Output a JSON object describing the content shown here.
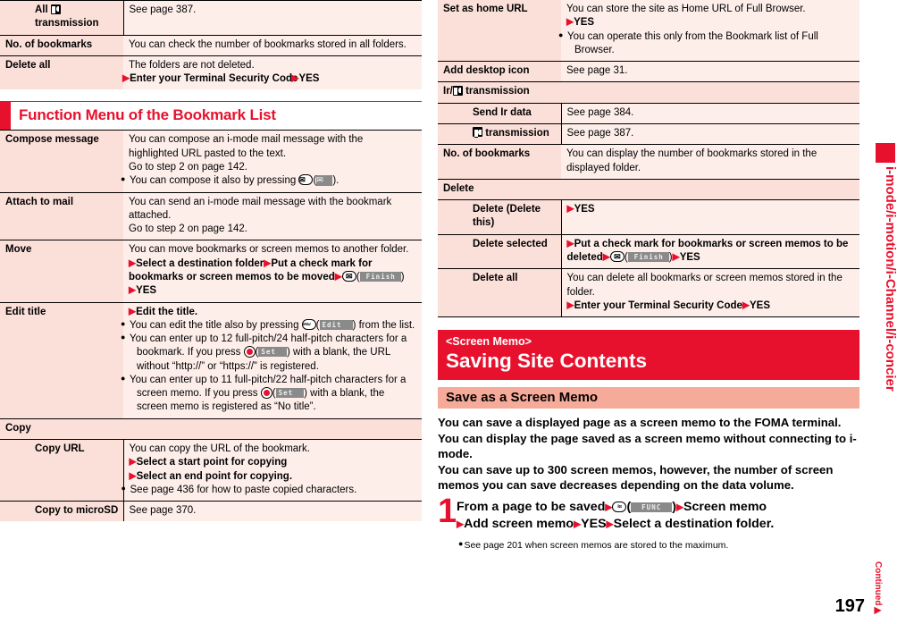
{
  "page_number": "197",
  "continued_label": "Continued",
  "side_tab_label": "i-mode/i-motion/i-Channel/i-concier",
  "colors": {
    "accent_red": "#e8112d",
    "label_pink": "#fbdfd9",
    "desc_pink": "#fdeeea",
    "subhead_pink": "#f6aa9a"
  },
  "left_column": {
    "top_table": {
      "rows": [
        {
          "label_prefix": "All",
          "label_icon": "ic-transmission-icon",
          "label_suffix": "transmission",
          "nested": true,
          "desc": "See page 387."
        },
        {
          "label": "No. of bookmarks",
          "desc": "You can check the number of bookmarks stored in all folders."
        },
        {
          "label": "Delete all",
          "desc_line1": "The folders are not deleted.",
          "desc_line2_tri": "▶",
          "desc_line2_bold": "Enter your Terminal Security Code",
          "desc_line2_tri2": "▶",
          "desc_line2_bold2": "YES"
        }
      ]
    },
    "section_heading": "Function Menu of the Bookmark List",
    "fn_table": {
      "rows": [
        {
          "label": "Compose message",
          "lines": [
            "You can compose an i-mode mail message with the",
            "highlighted URL pasted to the text.",
            "Go to step 2 on page 142."
          ],
          "note": "You can compose it also by pressing",
          "note_key": "envelope-key",
          "note_softkey": "envelope-softkey",
          "note_tail": "."
        },
        {
          "label": "Attach to mail",
          "lines": [
            "You can send an i-mode mail message with the bookmark",
            "attached.",
            "Go to step 2 on page 142."
          ]
        },
        {
          "label": "Move",
          "lines": [
            "You can move bookmarks or screen memos to another folder."
          ],
          "steps_bold": "Select a destination folder",
          "steps_bold2": "Put a check mark for bookmarks or screen memos to be moved",
          "steps_softkey": "Finish",
          "steps_bold3": "YES"
        },
        {
          "label": "Edit title",
          "steps_bold": "Edit the title.",
          "notes": [
            {
              "pre": "You can edit the title also by pressing",
              "key": "menu-key",
              "softkey": "Edit",
              "post": ") from the list."
            },
            {
              "pre": "You can enter up to 12 full-pitch/24 half-pitch characters for a bookmark. If you press",
              "key": "ok-key",
              "softkey": "Set",
              "post": ") with a blank, the URL without “http://” or “https://” is registered."
            },
            {
              "pre": "You can enter up to 11 full-pitch/22 half-pitch characters for a screen memo. If you press",
              "key": "ok-key",
              "softkey": "Set",
              "post": ") with a blank, the screen memo is registered as “No title”."
            }
          ]
        },
        {
          "group_label": "Copy"
        },
        {
          "label": "Copy URL",
          "nested": true,
          "lines": [
            "You can copy the URL of the bookmark."
          ],
          "steps_bold": "Select a start point for copying",
          "steps_bold2": "Select an end point for copying.",
          "note": "See page 436 for how to paste copied characters."
        },
        {
          "label": "Copy to microSD",
          "nested": true,
          "desc": "See page 370."
        }
      ]
    }
  },
  "right_column": {
    "cont_table": {
      "rows": [
        {
          "label": "Set as home URL",
          "lines": [
            "You can store the site as Home URL of Full Browser."
          ],
          "steps_bold": "YES",
          "note": "You can operate this only from the Bookmark list of Full Browser."
        },
        {
          "label": "Add desktop icon",
          "desc": "See page 31."
        },
        {
          "group_prefix": "Ir/",
          "group_icon": "ic-transmission-icon",
          "group_suffix": "transmission"
        },
        {
          "label": "Send Ir data",
          "nested": true,
          "desc": "See page 384."
        },
        {
          "label_icon": "ic-transmission-icon",
          "label_suffix": "transmission",
          "nested": true,
          "desc": "See page 387."
        },
        {
          "label": "No. of bookmarks",
          "lines": [
            "You can display the number of bookmarks stored in the",
            "displayed folder."
          ]
        },
        {
          "group_label": "Delete"
        },
        {
          "label": "Delete (Delete this)",
          "nested": true,
          "steps_bold": "YES"
        },
        {
          "label": "Delete selected",
          "nested": true,
          "steps_bold": "Put a check mark for bookmarks or screen memos to be deleted",
          "steps_softkey": "Finish",
          "steps_bold2": "YES"
        },
        {
          "label": "Delete all",
          "nested": true,
          "lines": [
            "You can delete all bookmarks or screen memos stored in the folder."
          ],
          "steps_bold": "Enter your Terminal Security Code",
          "steps_bold2": "YES"
        }
      ]
    },
    "banner": {
      "eyebrow": "<Screen Memo>",
      "title": "Saving Site Contents"
    },
    "subhead": "Save as a Screen Memo",
    "intro_paragraphs": [
      "You can save a displayed page as a screen memo to the FOMA terminal. You can display the page saved as a screen memo without connecting to i-mode.",
      "You can save up to 300 screen memos, however, the number of screen memos you can save decreases depending on the data volume."
    ],
    "step": {
      "number": "1",
      "text_a": "From a page to be saved",
      "key": "imode-alpha-key",
      "softkey": "FUNC",
      "text_b": "Screen memo",
      "text_c": "Add screen memo",
      "text_d": "YES",
      "text_e": "Select a destination folder.",
      "note": "See page 201 when screen memos are stored to the maximum."
    }
  }
}
